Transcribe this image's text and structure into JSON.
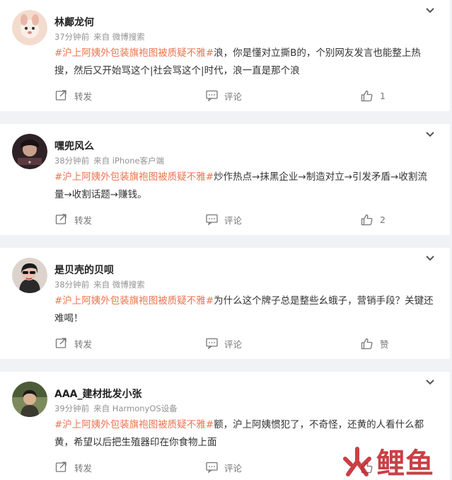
{
  "comments": [
    {
      "user": "林鄺龙何",
      "time": "37分钟前",
      "source": "来自 微博搜索",
      "hashtag": "#沪上阿姨外包装旗袍图被质疑不雅#",
      "text": "浪，你是懂对立撕B的，个别网友发言也能整上热搜，然后又开始骂这个|社会骂这个|时代，浪一直是那个浪",
      "repost_label": "转发",
      "comment_label": "评论",
      "like_label": "1",
      "avatar_color": "#f0d6c8"
    },
    {
      "user": "嘿兜风么",
      "time": "38分钟前",
      "source": "来自 iPhone客户端",
      "hashtag": "#沪上阿姨外包装旗袍图被质疑不雅#",
      "text": "炒作热点→抹黑企业→制造对立→引发矛盾→收割流量→收割话题→赚钱。",
      "repost_label": "转发",
      "comment_label": "评论",
      "like_label": "2",
      "avatar_color": "#3a2a2e"
    },
    {
      "user": "是贝壳的贝呗",
      "time": "38分钟前",
      "source": "来自 微博搜索",
      "hashtag": "#沪上阿姨外包装旗袍图被质疑不雅#",
      "text": "为什么这个牌子总是整些幺蛾子，营销手段？关键还难喝！",
      "repost_label": "转发",
      "comment_label": "评论",
      "like_label": "赞",
      "avatar_color": "#d9cfc8"
    },
    {
      "user": "AAA_建材批发小张",
      "time": "39分钟前",
      "source": "来自 HarmonyOS设备",
      "hashtag": "#沪上阿姨外包装旗袍图被质疑不雅#",
      "text": "额，沪上阿姨惯犯了，不奇怪，还黄的人看什么都黄，希望以后把生殖器印在你食物上面",
      "repost_label": "转发",
      "comment_label": "评论",
      "like_label": "",
      "avatar_color": "#6b7a52"
    }
  ],
  "watermark": {
    "text": "鲤鱼",
    "color": "#c01f26"
  }
}
